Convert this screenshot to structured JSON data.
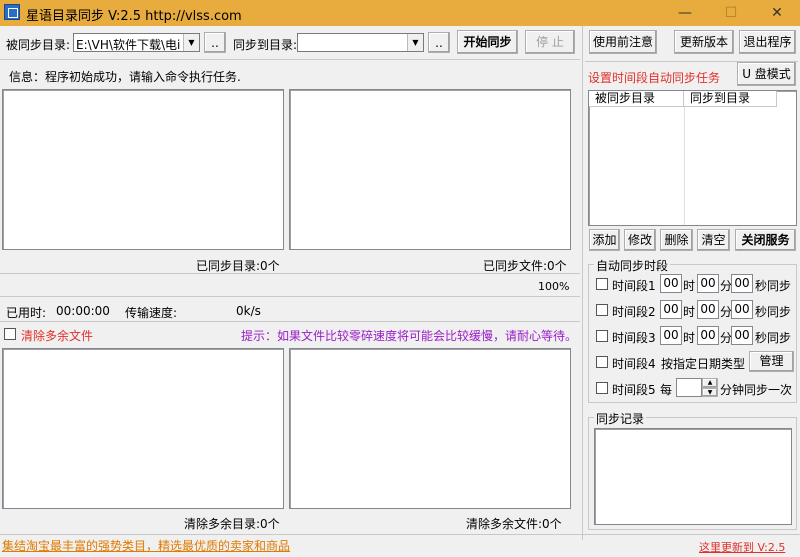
{
  "window": {
    "title": "星语目录同步 V:2.5 http://vlss.com",
    "minimize": "—",
    "maximize": "☐",
    "close": "✕"
  },
  "toolbar": {
    "source_label": "被同步目录:",
    "source_value": "E:\\VH\\软件下载\\电i",
    "browse_label": "..",
    "target_label": "同步到目录:",
    "target_value": "",
    "browse2_label": "..",
    "start_label": "开始同步",
    "stop_label": "停 止"
  },
  "right_buttons": {
    "notes": "使用前注意",
    "update": "更新版本",
    "exit": "退出程序",
    "usb": "U 盘模式"
  },
  "info": {
    "text": "信息：程序初始成功，请输入命令执行任务."
  },
  "panes": {
    "synced_dirs": "已同步目录:0个",
    "synced_files": "已同步文件:0个",
    "progress": "100%",
    "elapsed_label": "已用时:",
    "elapsed_value": "00:00:00",
    "speed_label": "传输速度:",
    "speed_value": "0k/s",
    "clean_label": "清除多余文件",
    "hint": "提示：如果文件比较零碎速度将可能会比较缓慢，请耐心等待。",
    "removed_dirs": "清除多余目录:0个",
    "removed_files": "清除多余文件:0个"
  },
  "schedule": {
    "title": "设置时间段自动同步任务",
    "col_source": "被同步目录",
    "col_target": "同步到目录",
    "add": "添加",
    "edit": "修改",
    "delete": "删除",
    "clear": "清空",
    "stop_service": "关闭服务"
  },
  "auto": {
    "group_title": "自动同步时段",
    "rows": [
      {
        "label": "时间段1",
        "h": "00",
        "hour_unit": "时",
        "m": "00",
        "min_unit": "分",
        "s": "00",
        "sec_unit": "秒同步"
      },
      {
        "label": "时间段2",
        "h": "00",
        "hour_unit": "时",
        "m": "00",
        "min_unit": "分",
        "s": "00",
        "sec_unit": "秒同步"
      },
      {
        "label": "时间段3",
        "h": "00",
        "hour_unit": "时",
        "m": "00",
        "min_unit": "分",
        "s": "00",
        "sec_unit": "秒同步"
      }
    ],
    "row4_label": "时间段4",
    "row4_text": "按指定日期类型",
    "manage": "管理",
    "row5_label": "时间段5",
    "row5_every": "每",
    "row5_tail": "分钟同步一次"
  },
  "log": {
    "title": "同步记录"
  },
  "status": {
    "left": "集结淘宝最丰富的强势类目，精选最优质的卖家和商品",
    "right": "这里更新到 V:2.5"
  }
}
